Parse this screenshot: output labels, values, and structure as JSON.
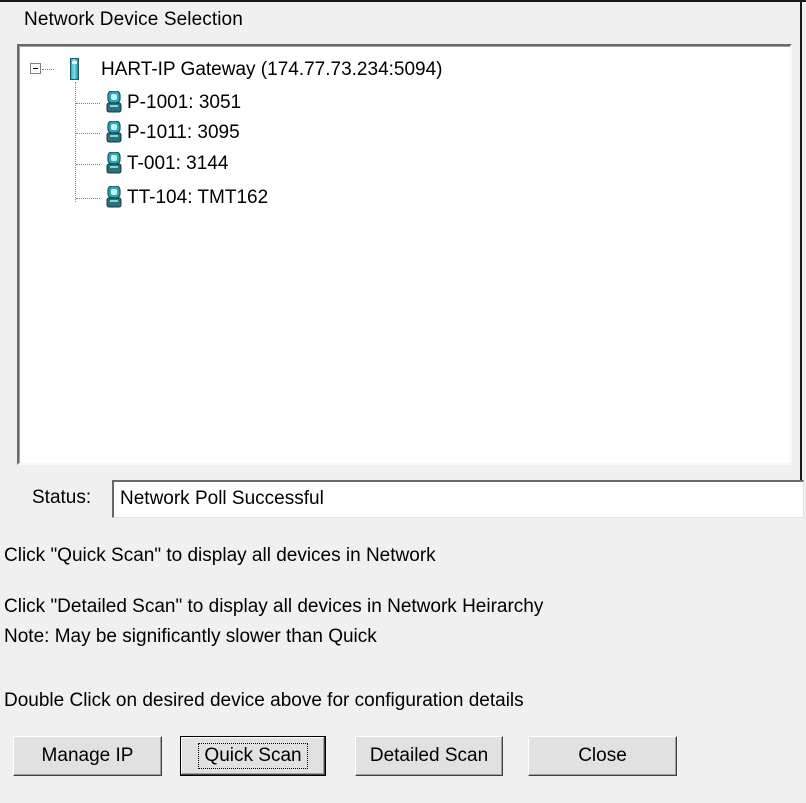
{
  "window": {
    "group_title": "Network Device Selection"
  },
  "tree": {
    "root": {
      "label": "HART-IP Gateway (174.77.73.234:5094)",
      "icon": "gateway-icon",
      "expanded": true
    },
    "children": [
      {
        "label": "P-1001: 3051",
        "icon": "field-device-icon"
      },
      {
        "label": "P-1011: 3095",
        "icon": "field-device-icon"
      },
      {
        "label": "T-001: 3144",
        "icon": "field-device-icon"
      },
      {
        "label": "TT-104: TMT162",
        "icon": "field-device-icon"
      }
    ]
  },
  "status": {
    "label": "Status:",
    "value": "Network Poll Successful"
  },
  "info": {
    "quick_scan_hint": "Click \"Quick Scan\" to display all devices in Network",
    "detailed_scan_hint": "Click \"Detailed Scan\" to display all devices in Network Heirarchy",
    "detailed_scan_note": "Note: May be significantly slower than Quick",
    "double_click_hint": "Double Click on desired device above for configuration details"
  },
  "buttons": {
    "manage_ip": "Manage IP",
    "quick_scan": "Quick Scan",
    "detailed_scan": "Detailed Scan",
    "close": "Close"
  },
  "colors": {
    "dialog_bg": "#f0f0f0",
    "device_icon_teal": "#2aa7b8",
    "device_icon_dark": "#1d4f57"
  }
}
